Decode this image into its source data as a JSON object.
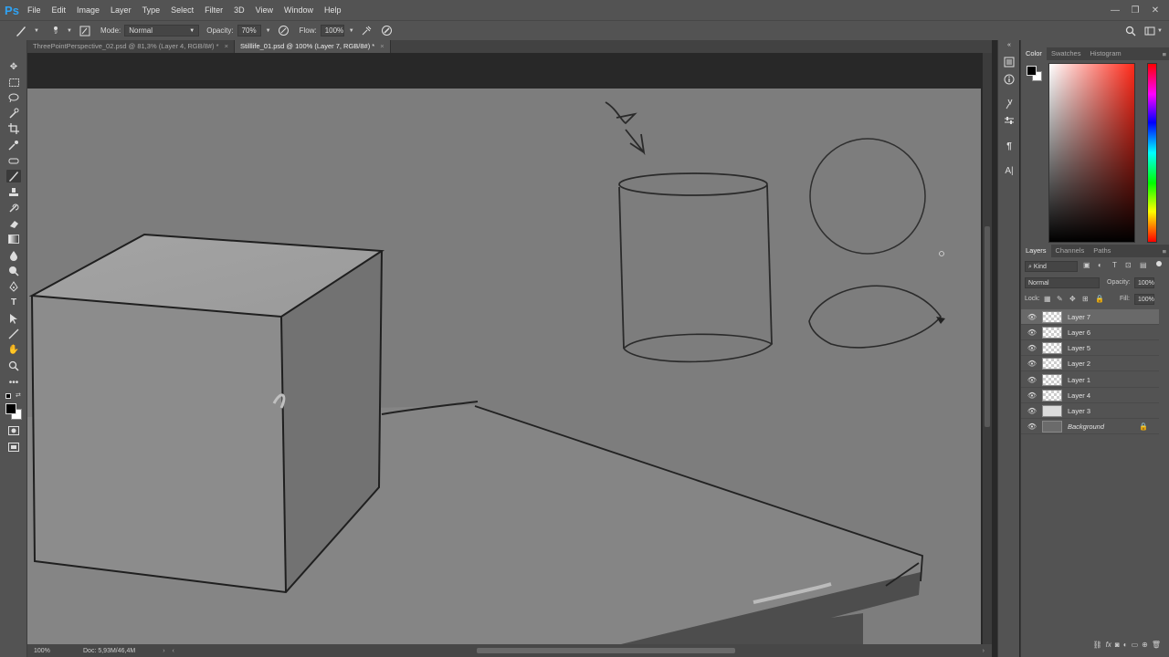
{
  "app": {
    "logo": "Ps"
  },
  "menubar": {
    "items": [
      "File",
      "Edit",
      "Image",
      "Layer",
      "Type",
      "Select",
      "Filter",
      "3D",
      "View",
      "Window",
      "Help"
    ],
    "window_controls": {
      "minimize": "—",
      "restore": "❐",
      "close": "✕"
    }
  },
  "options": {
    "brush_size": "9",
    "mode_label": "Mode:",
    "mode_value": "Normal",
    "opacity_label": "Opacity:",
    "opacity_value": "70%",
    "flow_label": "Flow:",
    "flow_value": "100%"
  },
  "tabs": [
    {
      "label": "ThreePointPerspective_02.psd @ 81,3% (Layer 4, RGB/8#) *",
      "active": false
    },
    {
      "label": "Stilllife_01.psd @ 100% (Layer 7, RGB/8#) *",
      "active": true
    }
  ],
  "status": {
    "zoom": "100%",
    "doc": "Doc: 5,93M/46,4M"
  },
  "color_panel": {
    "tabs": [
      "Color",
      "Swatches",
      "Histogram"
    ],
    "foreground": "#000000",
    "background": "#ffffff"
  },
  "layers_panel": {
    "tabs": [
      "Layers",
      "Channels",
      "Paths"
    ],
    "kind_label": "Kind",
    "blend_mode": "Normal",
    "opacity_label": "Opacity:",
    "opacity_value": "100%",
    "lock_label": "Lock:",
    "fill_label": "Fill:",
    "fill_value": "100%",
    "layers": [
      {
        "name": "Layer 7",
        "selected": true,
        "thumb": "transparent"
      },
      {
        "name": "Layer 6",
        "selected": false,
        "thumb": "transparent"
      },
      {
        "name": "Layer 5",
        "selected": false,
        "thumb": "transparent"
      },
      {
        "name": "Layer 2",
        "selected": false,
        "thumb": "transparent"
      },
      {
        "name": "Layer 1",
        "selected": false,
        "thumb": "transparent"
      },
      {
        "name": "Layer 4",
        "selected": false,
        "thumb": "transparent"
      },
      {
        "name": "Layer 3",
        "selected": false,
        "thumb": "mask"
      },
      {
        "name": "Background",
        "selected": false,
        "thumb": "solid",
        "locked": true
      }
    ]
  },
  "canvas": {
    "background_color": "#7d7d7d"
  }
}
